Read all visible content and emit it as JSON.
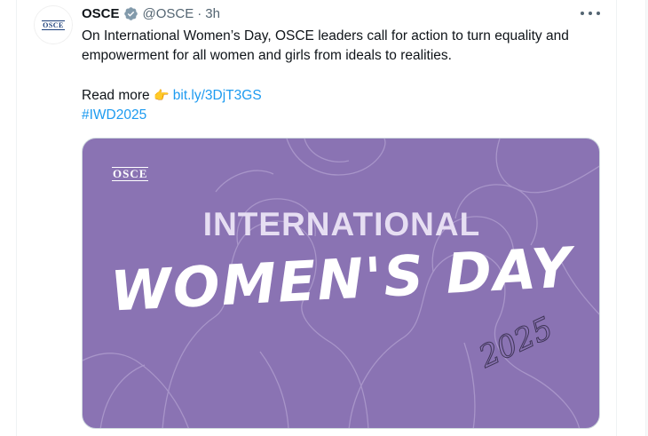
{
  "tweet": {
    "author": {
      "name": "OSCE",
      "handle": "@OSCE",
      "avatar_text": "OSCE",
      "verified_icon": "verified-badge-icon"
    },
    "time_separator": "·",
    "time": "3h",
    "more_icon": "more-horizontal-icon",
    "text_line1": "On International Women’s Day, OSCE leaders call for action to turn equality and empowerment for all women and girls from ideals to realities.",
    "read_more_label": "Read more",
    "pointing_emoji": "👉",
    "link_text": "bit.ly/3DjT3GS",
    "hashtag": "#IWD2025"
  },
  "media": {
    "logo_text": "OSCE",
    "line1": "INTERNATIONAL",
    "line2": "WOMEN'S DAY",
    "year": "2025"
  },
  "colors": {
    "link": "#1d9bf0",
    "media_bg": "#8a73b3",
    "verified": "#829aab"
  }
}
